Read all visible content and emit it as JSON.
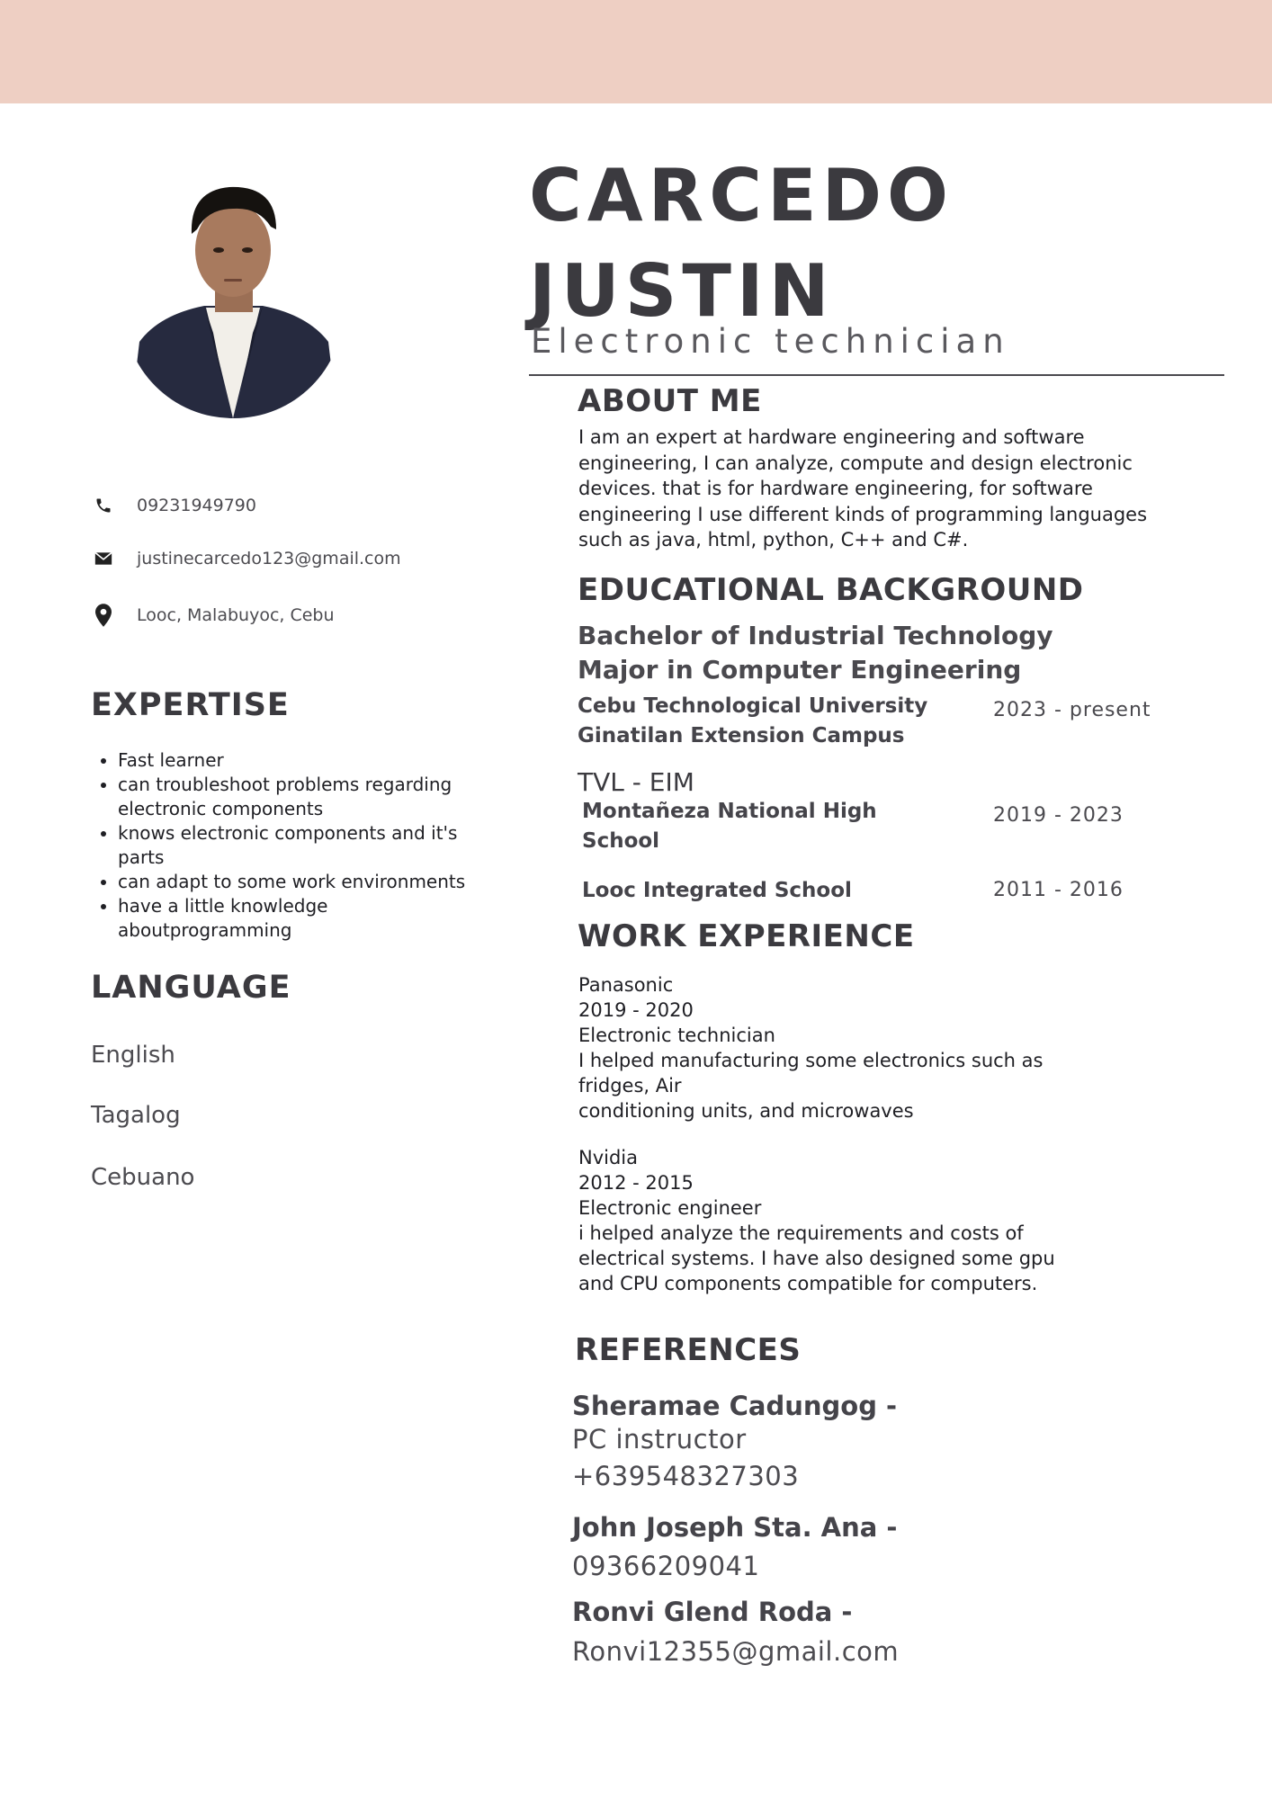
{
  "header": {
    "band_color": "#eecfc3"
  },
  "profile": {
    "name_line1": "CARCEDO",
    "name_line2": "JUSTIN",
    "role": "Electronic technician"
  },
  "contact": {
    "phone": "09231949790",
    "email": "justinecarcedo123@gmail.com",
    "address": "Looc, Malabuyoc, Cebu"
  },
  "expertise": {
    "heading": "EXPERTISE",
    "items": [
      "Fast learner",
      "can troubleshoot problems regarding electronic components",
      "knows electronic components and it's parts",
      "can adapt to some work environments",
      "have a little knowledge aboutprogramming"
    ]
  },
  "language": {
    "heading": "LANGUAGE",
    "items": [
      "English",
      "Tagalog",
      "Cebuano"
    ]
  },
  "about": {
    "heading": "ABOUT ME",
    "text": "I am an expert at hardware engineering and software engineering, I can analyze, compute and design electronic devices. that is for hardware engineering, for software engineering I use different kinds of programming languages such as java, html, python, C++ and C#."
  },
  "education": {
    "heading": "EDUCATIONAL BACKGROUND",
    "degree_line1": "Bachelor of Industrial Technology",
    "degree_line2": "Major in Computer Engineering",
    "college_line1": "Cebu Technological University",
    "college_line2": "Ginatilan Extension Campus",
    "college_years": "2023 - present",
    "track": "TVL - EIM",
    "hs_line1": "Montañeza National High",
    "hs_line2": "School",
    "hs_years": "2019 - 2023",
    "elem": "Looc Integrated School",
    "elem_years": "2011 - 2016"
  },
  "work": {
    "heading": "WORK EXPERIENCE",
    "jobs": [
      {
        "company": "Panasonic",
        "years": "2019 - 2020",
        "title": "Electronic technician",
        "desc_line1": "I helped manufacturing some electronics such as fridges, Air",
        "desc_line2": "conditioning units, and microwaves"
      },
      {
        "company": "Nvidia",
        "years": "2012 - 2015",
        "title": "Electronic engineer",
        "desc_line1": "i helped analyze the requirements and costs of electrical systems. I have also designed some gpu and CPU components compatible for computers.",
        "desc_line2": ""
      }
    ]
  },
  "references": {
    "heading": "REFERENCES",
    "items": [
      {
        "name": "Sheramae Cadungog -",
        "line1": "PC instructor",
        "line2": "+639548327303"
      },
      {
        "name": "John Joseph Sta. Ana -",
        "line1": "09366209041"
      },
      {
        "name": "Ronvi Glend Roda -",
        "line1": "Ronvi12355@gmail.com"
      }
    ]
  }
}
